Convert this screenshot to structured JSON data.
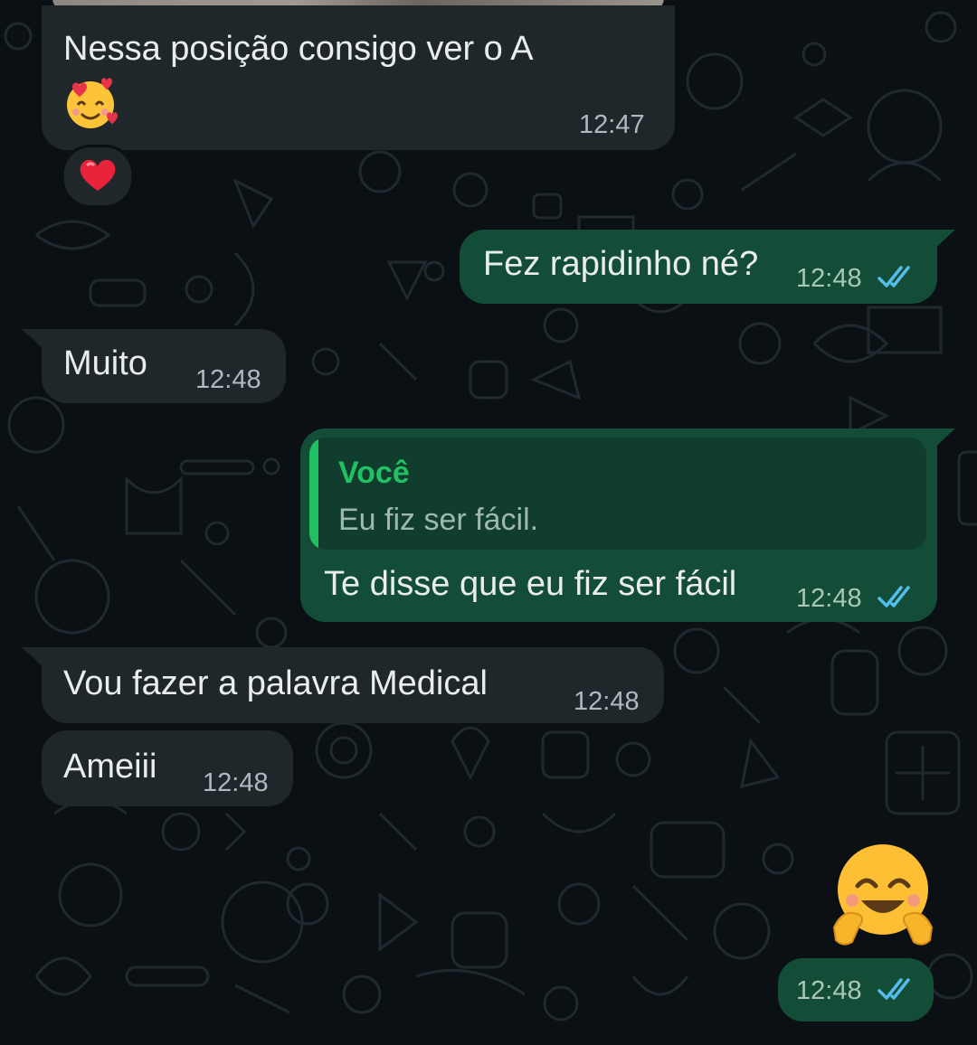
{
  "chat": {
    "messages": [
      {
        "direction": "in",
        "text": "Nessa posição  consigo ver o A",
        "emoji": "smiling-face-with-hearts",
        "time": "12:47",
        "reaction": "red-heart"
      },
      {
        "direction": "out",
        "text": "Fez rapidinho né?",
        "time": "12:48",
        "status": "read"
      },
      {
        "direction": "in",
        "text": "Muito",
        "time": "12:48"
      },
      {
        "direction": "out",
        "quote": {
          "author": "Você",
          "text": "Eu fiz ser fácil."
        },
        "text": "Te disse que eu fiz ser fácil",
        "time": "12:48",
        "status": "read"
      },
      {
        "direction": "in",
        "text": "Vou fazer a  palavra Medical",
        "time": "12:48"
      },
      {
        "direction": "in",
        "text": "Ameiii",
        "time": "12:48"
      },
      {
        "direction": "out",
        "emoji": "hugging-face",
        "time": "12:48",
        "status": "read"
      }
    ]
  },
  "colors": {
    "background": "#0b1014",
    "incoming_bubble": "#1f272a",
    "outgoing_bubble": "#144d37",
    "read_ticks": "#53bdeb",
    "quote_accent": "#21c063"
  }
}
